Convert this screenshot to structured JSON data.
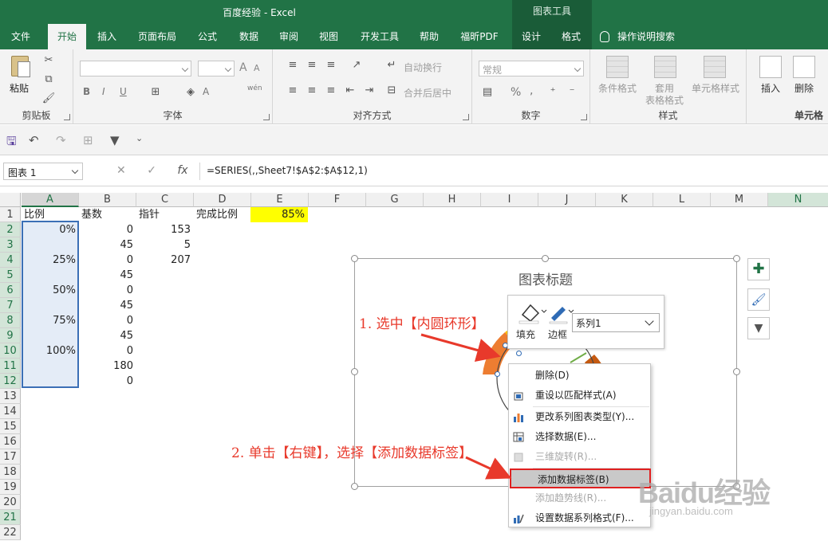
{
  "titlebar": {
    "title": "百度经验  -  Excel",
    "context_tools": "图表工具"
  },
  "tabs": [
    "文件",
    "开始",
    "插入",
    "页面布局",
    "公式",
    "数据",
    "审阅",
    "视图",
    "开发工具",
    "帮助",
    "福昕PDF",
    "设计",
    "格式"
  ],
  "active_tab": "开始",
  "tell_me": "操作说明搜索",
  "ribbon": {
    "clipboard": {
      "paste": "粘贴",
      "label": "剪贴板"
    },
    "font": {
      "label": "字体",
      "bold": "B",
      "italic": "I",
      "underline": "U",
      "wen": "wén",
      "grow": "A",
      "shrink": "A"
    },
    "alignment": {
      "wrap": "自动换行",
      "merge": "合并后居中",
      "label": "对齐方式"
    },
    "number": {
      "format": "常规",
      "percent": "%",
      "comma": ",",
      "label": "数字"
    },
    "styles": {
      "conditional": "条件格式",
      "table1": "套用",
      "table2": "表格格式",
      "cell_style": "单元格样式",
      "label": "样式"
    },
    "cells": {
      "insert": "插入",
      "delete": "删除",
      "label": "单元格"
    }
  },
  "formula_bar": {
    "name_box": "图表 1",
    "fx": "fx",
    "formula": "=SERIES(,,Sheet7!$A$2:$A$12,1)"
  },
  "sheet": {
    "columns": [
      "A",
      "B",
      "C",
      "D",
      "E",
      "F",
      "G",
      "H",
      "I",
      "J",
      "K",
      "L",
      "M",
      "N"
    ],
    "rows": [
      "1",
      "2",
      "3",
      "4",
      "5",
      "6",
      "7",
      "8",
      "9",
      "10",
      "11",
      "12",
      "13",
      "14",
      "15",
      "16",
      "17",
      "18",
      "19",
      "20",
      "21",
      "22"
    ],
    "header_row": {
      "A": "比例",
      "B": "基数",
      "C": "指针",
      "D": "完成比例",
      "E": "85%"
    },
    "col_a": [
      "0%",
      "",
      "25%",
      "",
      "50%",
      "",
      "75%",
      "",
      "100%",
      "",
      ""
    ],
    "col_b": [
      "0",
      "45",
      "0",
      "45",
      "0",
      "45",
      "0",
      "45",
      "0",
      "180",
      "0"
    ],
    "col_c": [
      "153",
      "5",
      "207"
    ]
  },
  "chart": {
    "title": "图表标题",
    "side_buttons": [
      "+",
      "brush",
      "filter"
    ]
  },
  "mini_toolbar": {
    "fill": "填充",
    "border": "边框",
    "series": "系列1"
  },
  "context_menu": [
    {
      "label": "删除(D)",
      "disabled": false,
      "icon": ""
    },
    {
      "label": "重设以匹配样式(A)",
      "disabled": false,
      "icon": "reset-style-icon"
    },
    {
      "label": "更改系列图表类型(Y)...",
      "disabled": false,
      "icon": "chart-type-icon"
    },
    {
      "label": "选择数据(E)...",
      "disabled": false,
      "icon": "select-data-icon"
    },
    {
      "label": "三维旋转(R)...",
      "disabled": true,
      "icon": "rotate-3d-icon"
    },
    {
      "label": "添加数据标签(B)",
      "disabled": false,
      "icon": "",
      "highlighted": true
    },
    {
      "label": "添加趋势线(R)...",
      "disabled": true,
      "icon": ""
    },
    {
      "label": "设置数据系列格式(F)...",
      "disabled": false,
      "icon": "format-series-icon"
    }
  ],
  "annotations": {
    "step1": "1. 选中【内圆环形】",
    "step2": "2. 单击【右键】，选择【添加数据标签】"
  },
  "watermark": {
    "logo": "Baidu经验",
    "url": "jingyan.baidu.com"
  },
  "colors": {
    "excel_green": "#217346",
    "annotation_red": "#e8392b",
    "highlight_yellow": "#ffff00",
    "selection_blue": "#3b6fb6"
  }
}
